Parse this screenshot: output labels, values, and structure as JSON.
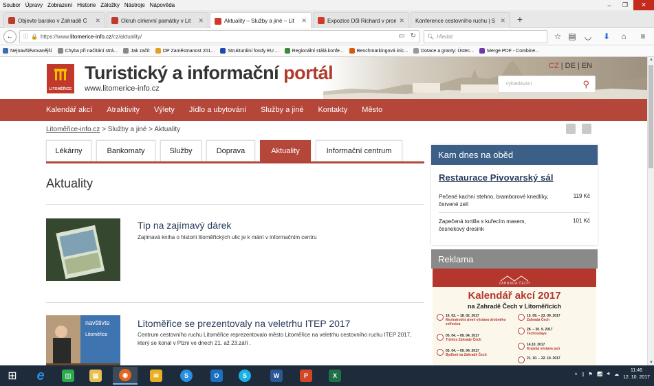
{
  "menubar": {
    "items": [
      "Soubor",
      "Úpravy",
      "Zobrazení",
      "Historie",
      "Záložky",
      "Nástroje",
      "Nápověda"
    ]
  },
  "window_controls": {
    "minimize": "–",
    "maximize": "❐",
    "close": "✕"
  },
  "tabs": [
    {
      "title": "Objevte baroko v Zahradě Č",
      "color": "#c0392b",
      "active": false
    },
    {
      "title": "Okruh církevní památky v Lit",
      "color": "#c0392b",
      "active": false
    },
    {
      "title": "Aktuality – Služby a jiné – Lit",
      "color": "#d0392b",
      "active": true
    },
    {
      "title": "Expozice Důl Richard v prom",
      "color": "#d0392b",
      "active": false
    },
    {
      "title": "Konference cestovního ruchu | S",
      "color": "#cccccc",
      "active": false
    }
  ],
  "new_tab": "+",
  "navbar": {
    "url_prefix": "https://www.",
    "url_domain": "litomerice-info.cz",
    "url_path": "/cz/aktuality/",
    "search_placeholder": "Hledat"
  },
  "bookmarks": [
    {
      "label": "Nejnavštěvovanější",
      "color": "#3b6db5"
    },
    {
      "label": "Chyba při načítání strá...",
      "color": "#888888"
    },
    {
      "label": "Jak začít",
      "color": "#888888"
    },
    {
      "label": "OP Zaměstnanost 201...",
      "color": "#e0a020"
    },
    {
      "label": "Strukturální fondy EU ...",
      "color": "#1f4aa8"
    },
    {
      "label": "Regionální stálá konfe...",
      "color": "#3a8a3a"
    },
    {
      "label": "Benchmarkingová inic...",
      "color": "#d45a10"
    },
    {
      "label": "Dotace a granty: Ústec...",
      "color": "#999999"
    },
    {
      "label": "Merge PDF - Combine...",
      "color": "#6a3aa8"
    }
  ],
  "site": {
    "title_main": "Turistický a informační ",
    "title_accent": "portál",
    "url": "www.litomerice-info.cz",
    "logo_caption": "LITOMĚŘICE",
    "langs": {
      "cz": "CZ",
      "sep": " | ",
      "de": "DE",
      "en": "EN"
    },
    "search_placeholder": "Vyhledávání"
  },
  "mainnav": [
    "Kalendář akcí",
    "Atraktivity",
    "Výlety",
    "Jídlo a ubytování",
    "Služby a jiné",
    "Kontakty",
    "Město"
  ],
  "breadcrumb": {
    "home": "Litoměřice-info.cz",
    "sep": " > ",
    "level1": "Služby a jiné",
    "current": "Aktuality"
  },
  "subtabs": [
    "Lékárny",
    "Bankomaty",
    "Služby",
    "Doprava",
    "Aktuality",
    "Informační centrum"
  ],
  "page_title": "Aktuality",
  "articles": [
    {
      "title": "Tip na zajímavý dárek",
      "text": "Zajímavá kniha o historii litoměřických ulic je k mání v informačním centru"
    },
    {
      "title": "Litoměřice se prezentovaly na veletrhu ITEP 2017",
      "text": "Centrum cestovního ruchu Litoměřice reprezentovalo město Litoměřice na veletrhu cestovního ruchu ITEP 2017, který se konal v Plzni ve dnech 21. až 23.září ."
    }
  ],
  "lunch": {
    "heading": "Kam dnes na oběd",
    "restaurant": "Restaurace Pivovarský sál",
    "dishes": [
      {
        "name": "Pečené kachní stehno, bramborové knedlíky, červené zelí",
        "price": "119 Kč"
      },
      {
        "name": "Zapečená tortilla s kuřecím masem, česnekový dresink",
        "price": "101 Kč"
      }
    ]
  },
  "ads": {
    "heading": "Reklama",
    "banner_top": "ZAHRADA ČECH",
    "banner_title": "Kalendář akcí 2017",
    "banner_subtitle": "na Zahradě Čech v Litoměřicích",
    "events": [
      {
        "date": "16. 02. – 18. 02. 2017",
        "name": "Mezinárodní zimní výstava drobného zvířectva"
      },
      {
        "date": "15. 09. – 23. 09. 2017",
        "name": "Zahrada Čech"
      },
      {
        "date": "05. 04. – 09. 04. 2017",
        "name": "Tržnice Zahrady Čech"
      },
      {
        "date": "28. – 30. 9. 2017",
        "name": "Technodays"
      },
      {
        "date": "05. 04. – 09. 04. 2017",
        "name": "Bydlení na Zahradě Čech"
      },
      {
        "date": "14.10. 2017",
        "name": "Krajská výstava psů"
      },
      {
        "date": "21. 10. – 22. 10. 2017",
        "name": ""
      }
    ]
  },
  "taskbar": {
    "apps": [
      {
        "name": "start",
        "glyph": "⊞",
        "color": "#ffffff"
      },
      {
        "name": "ie",
        "glyph": "e",
        "color": "#2a8fe0"
      },
      {
        "name": "store",
        "glyph": "◫",
        "color": "#2aa84a"
      },
      {
        "name": "explorer",
        "glyph": "▤",
        "color": "#e8c050"
      },
      {
        "name": "firefox",
        "glyph": "◉",
        "color": "#e8651c"
      },
      {
        "name": "mail",
        "glyph": "✉",
        "color": "#e8b020"
      },
      {
        "name": "skype-business",
        "glyph": "S",
        "color": "#2a8fe0"
      },
      {
        "name": "outlook",
        "glyph": "O",
        "color": "#1a6fc0"
      },
      {
        "name": "skype",
        "glyph": "S",
        "color": "#1ab0e8"
      },
      {
        "name": "word",
        "glyph": "W",
        "color": "#2b5797"
      },
      {
        "name": "powerpoint",
        "glyph": "P",
        "color": "#d24726"
      },
      {
        "name": "excel",
        "glyph": "X",
        "color": "#1e7145"
      }
    ],
    "time": "11:46",
    "date": "12. 10. 2017"
  }
}
